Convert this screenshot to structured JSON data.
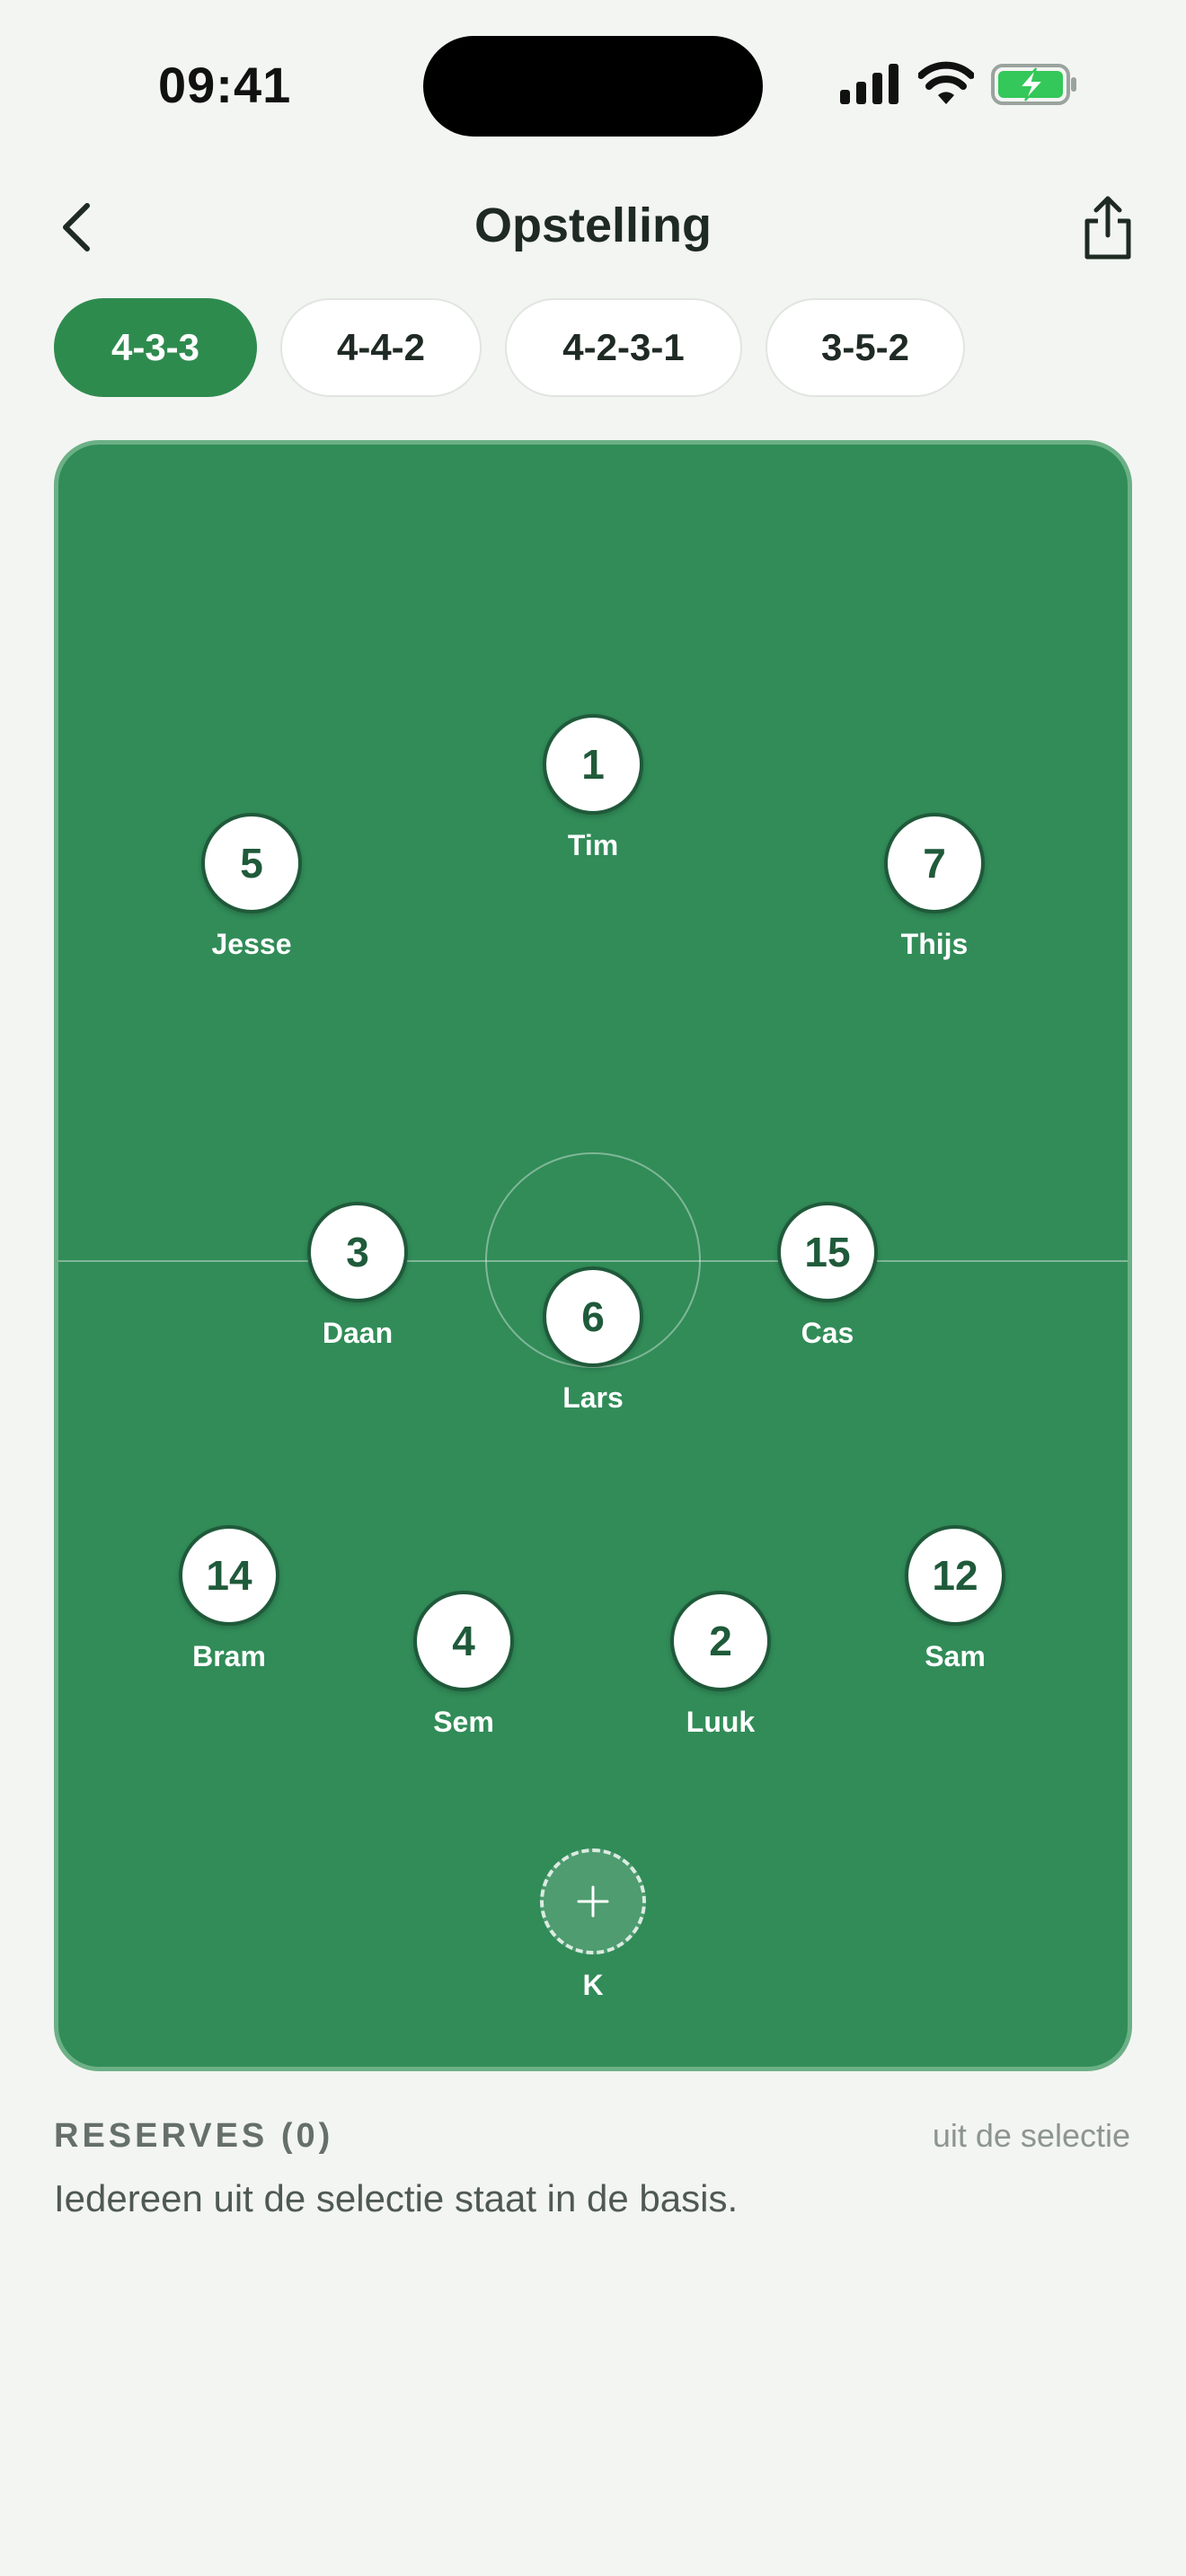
{
  "status_bar": {
    "time": "09:41"
  },
  "header": {
    "title": "Opstelling",
    "back_icon": "chevron-left-icon",
    "share_icon": "share-icon"
  },
  "formations": [
    {
      "label": "4-3-3",
      "active": true
    },
    {
      "label": "4-4-2",
      "active": false
    },
    {
      "label": "4-2-3-1",
      "active": false
    },
    {
      "label": "3-5-2",
      "active": false
    }
  ],
  "pitch": {
    "colors": {
      "pitch": "#318c58",
      "accent": "#2e8b4e",
      "disc_ring": "#1f5a3a"
    },
    "players": [
      {
        "number": "1",
        "name": "Tim"
      },
      {
        "number": "5",
        "name": "Jesse"
      },
      {
        "number": "7",
        "name": "Thijs"
      },
      {
        "number": "3",
        "name": "Daan"
      },
      {
        "number": "15",
        "name": "Cas"
      },
      {
        "number": "6",
        "name": "Lars"
      },
      {
        "number": "14",
        "name": "Bram"
      },
      {
        "number": "12",
        "name": "Sam"
      },
      {
        "number": "4",
        "name": "Sem"
      },
      {
        "number": "2",
        "name": "Luuk"
      }
    ],
    "empty_slot": {
      "label": "K",
      "icon": "plus-icon"
    }
  },
  "reserves": {
    "title": "RESERVES (0)",
    "link": "uit de selectie",
    "empty_text": "Iedereen uit de selectie staat in de basis."
  }
}
